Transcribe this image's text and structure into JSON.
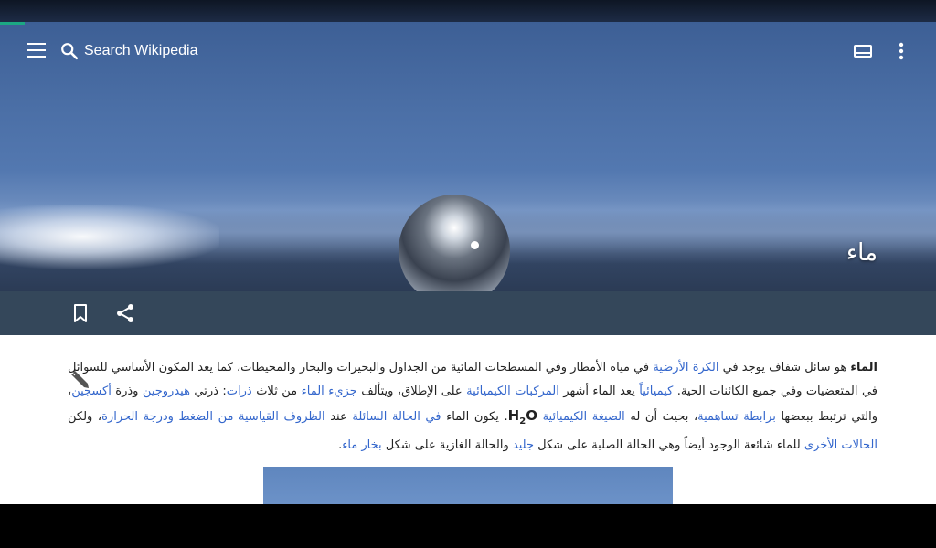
{
  "toolbar": {
    "search_placeholder": "Search Wikipedia",
    "menu_icon": "hamburger-menu-icon",
    "search_icon": "search-icon",
    "tabs_icon": "tabs-icon",
    "overflow_icon": "more-vert-icon"
  },
  "article": {
    "title": "ماء"
  },
  "actions": {
    "bookmark_icon": "bookmark-icon",
    "share_icon": "share-icon",
    "edit_icon": "pencil-icon"
  },
  "paragraph": {
    "s1": "الماء",
    "s2": " هو سائل شفاف يوجد في ",
    "s3": "الكرة الأرضية",
    "s4": " في مياه الأمطار وفي المسطحات المائية من الجداول والبحيرات والبحار والمحيطات، كما يعد المكون الأساسي للسوائل في المتعضيات وفي جميع الكائنات الحية. ",
    "s5": "كيميائياً",
    "s6": " يعد الماء أشهر ",
    "s7": "المركبات الكيميائية",
    "s8": " على الإطلاق، ويتألف ",
    "s9": "جزيء الماء",
    "s10": " من ثلاث ",
    "s11": "ذرات",
    "s12": ": ذرتي ",
    "s13": "هيدروجين",
    "s14": " وذرة ",
    "s15": "أكسجين",
    "s16": "، والتي ترتبط ببعضها ",
    "s17": "برابطة تساهمية",
    "s18": "، بحيث أن له ",
    "s19": "الصيغة الكيميائية",
    "s20_h": "H",
    "s20_sub": "2",
    "s20_o": "O",
    "s21": ". يكون الماء ",
    "s22": "في الحالة السائلة",
    "s23": " عند ",
    "s24": "الظروف القياسية من الضغط ودرجة الحرارة",
    "s25": "، ولكن ",
    "s26": "الحالات الأخرى",
    "s27": " للماء شائعة الوجود أيضاً وهي الحالة الصلبة على شكل ",
    "s28": "جليد",
    "s29": " والحالة الغازية على شكل ",
    "s30": "بخار ماء",
    "s31": "."
  },
  "colors": {
    "link": "#3366cc",
    "action_bar": "#34475a",
    "load_bar": "#1ca883"
  }
}
